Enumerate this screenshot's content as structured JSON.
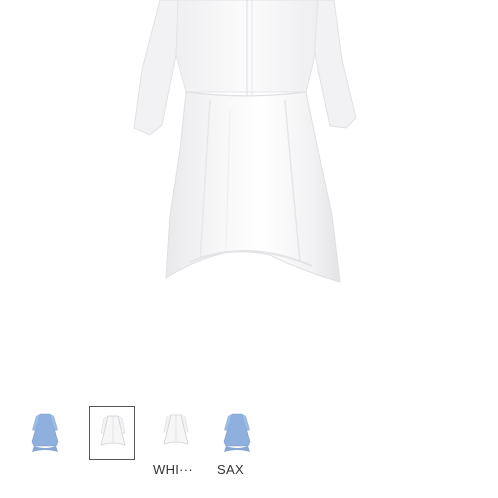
{
  "product_gallery": {
    "main_image": {
      "icon": "white-peplum-shirt-dress-image",
      "color": "#ffffff"
    },
    "thumbnails": [
      {
        "icon": "blue-shirt-dress-thumbnail",
        "color": "#8fb0dc",
        "label": "",
        "selected": false
      },
      {
        "icon": "white-shirt-dress-thumbnail",
        "color": "#f4f4f4",
        "label": "",
        "selected": true
      },
      {
        "icon": "white-shirt-dress-color-swatch",
        "color": "#f4f4f4",
        "label": "WHI···",
        "selected": false
      },
      {
        "icon": "sax-blue-shirt-dress-color-swatch",
        "color": "#8fb0dc",
        "label": "SAX",
        "selected": false
      }
    ]
  }
}
